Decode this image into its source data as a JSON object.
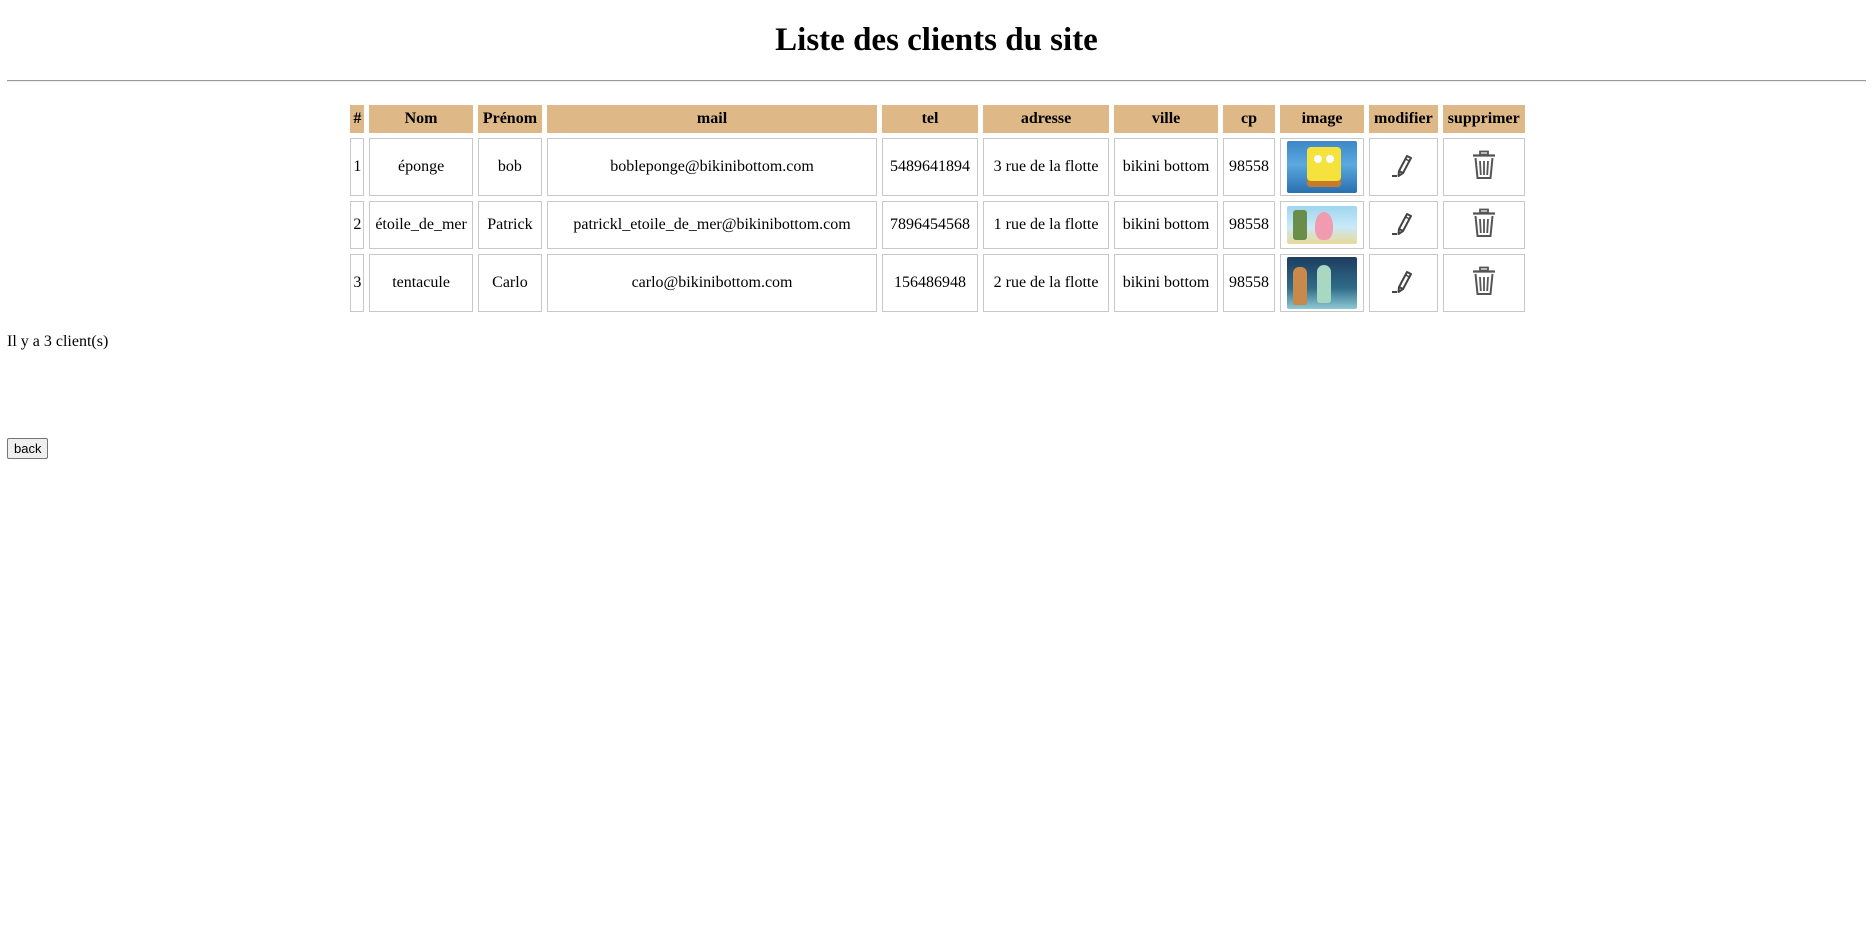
{
  "page": {
    "title": "Liste des clients du site",
    "count_text": "Il y a 3 client(s)",
    "back_label": "back"
  },
  "table": {
    "headers": [
      "#",
      "Nom",
      "Prénom",
      "mail",
      "tel",
      "adresse",
      "ville",
      "cp",
      "image",
      "modifier",
      "supprimer"
    ],
    "rows": [
      {
        "num": "1",
        "nom": "éponge",
        "prenom": "bob",
        "mail": "bobleponge@bikinibottom.com",
        "tel": "5489641894",
        "adresse": "3 rue de la flotte",
        "ville": "bikini bottom",
        "cp": "98558",
        "image": "spongebob-thumbnail"
      },
      {
        "num": "2",
        "nom": "étoile_de_mer",
        "prenom": "Patrick",
        "mail": "patrickl_etoile_de_mer@bikinibottom.com",
        "tel": "7896454568",
        "adresse": "1 rue de la flotte",
        "ville": "bikini bottom",
        "cp": "98558",
        "image": "patrick-thumbnail"
      },
      {
        "num": "3",
        "nom": "tentacule",
        "prenom": "Carlo",
        "mail": "carlo@bikinibottom.com",
        "tel": "156486948",
        "adresse": "2 rue de la flotte",
        "ville": "bikini bottom",
        "cp": "98558",
        "image": "squidward-thumbnail"
      }
    ]
  },
  "icons": {
    "edit": "pencil-icon",
    "delete": "trash-icon"
  },
  "colors": {
    "header_bg": "#deb887",
    "cell_border": "#c8c8c8",
    "icon": "#444444"
  }
}
